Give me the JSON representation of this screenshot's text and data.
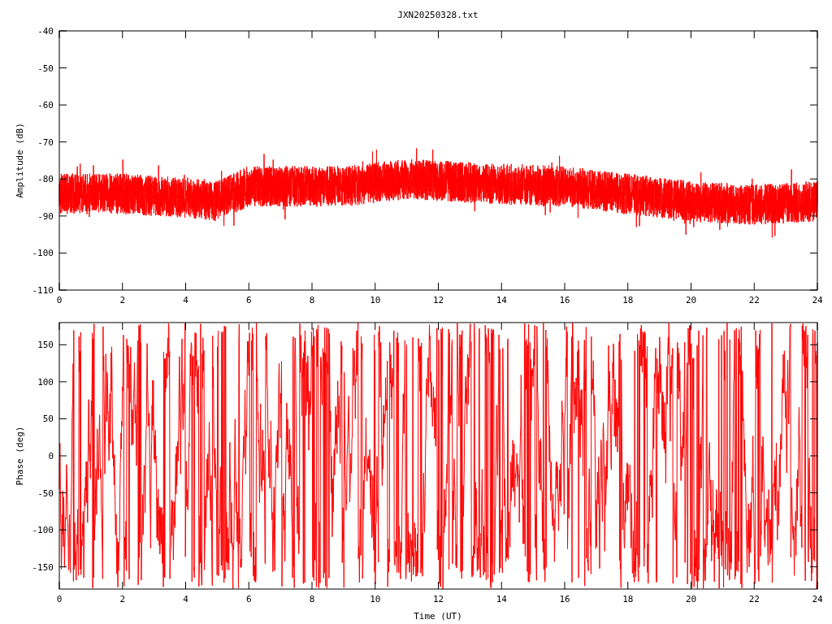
{
  "title": "JXN20250328.txt",
  "amplitude_panel": {
    "ylabel": "Amplitude (dB)",
    "yticks": [
      "-40",
      "-50",
      "-60",
      "-70",
      "-80",
      "-90",
      "-100",
      "-110"
    ],
    "xticks": [
      "0",
      "2",
      "4",
      "6",
      "8",
      "10",
      "12",
      "14",
      "16",
      "18",
      "20",
      "22",
      "24"
    ]
  },
  "phase_panel": {
    "ylabel": "Phase (deg)",
    "yticks": [
      "150",
      "100",
      "50",
      "0",
      "-50",
      "-100",
      "-150"
    ],
    "xticks": [
      "0",
      "2",
      "4",
      "6",
      "8",
      "10",
      "12",
      "14",
      "16",
      "18",
      "20",
      "22",
      "24"
    ],
    "xlabel": "Time (UT)"
  }
}
